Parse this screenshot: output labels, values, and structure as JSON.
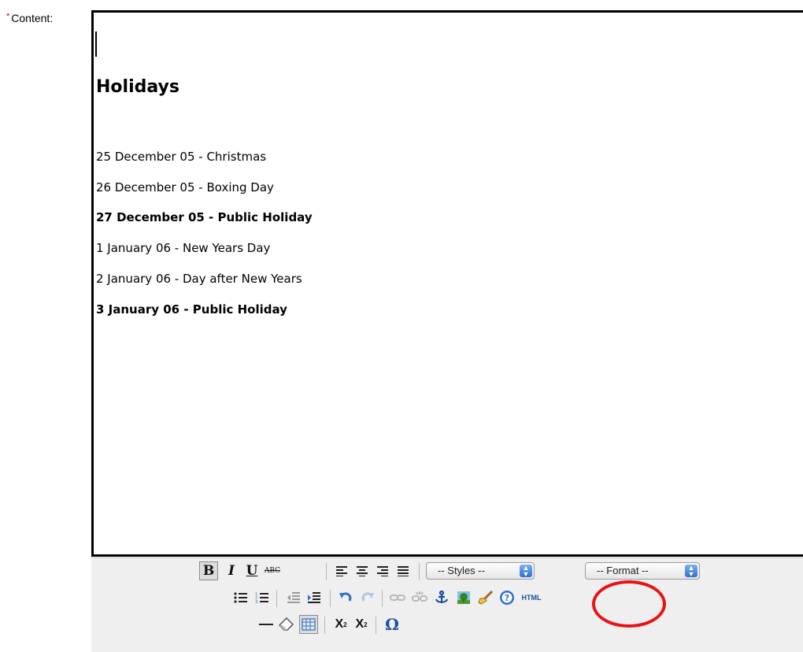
{
  "field": {
    "required_mark": "*",
    "label": "Content:"
  },
  "editor": {
    "heading": "Holidays",
    "lines": [
      {
        "text": "25 December 05 - Christmas",
        "bold": false
      },
      {
        "text": "26 December 05 - Boxing Day",
        "bold": false
      },
      {
        "text": "27 December 05 - Public Holiday",
        "bold": true
      },
      {
        "text": "1 January 06 - New Years Day",
        "bold": false
      },
      {
        "text": "2 January 06 - Day after New Years",
        "bold": false
      },
      {
        "text": "3 January 06 - Public Holiday",
        "bold": true
      }
    ]
  },
  "toolbar": {
    "bold_label": "B",
    "italic_label": "I",
    "underline_label": "U",
    "strike_label": "ABC",
    "styles_select": "-- Styles --",
    "format_select": "-- Format --",
    "html_label": "HTML",
    "subscript_label": "X",
    "superscript_label": "X",
    "charmap_label": "Ω"
  },
  "icons": [
    "bold-icon",
    "italic-icon",
    "underline-icon",
    "strikethrough-icon",
    "align-left-icon",
    "align-center-icon",
    "align-right-icon",
    "align-justify-icon",
    "bullet-list-icon",
    "numbered-list-icon",
    "outdent-icon",
    "indent-icon",
    "undo-icon",
    "redo-icon",
    "link-icon",
    "unlink-icon",
    "anchor-icon",
    "image-icon",
    "cleanup-icon",
    "help-icon",
    "html-source-icon",
    "horizontal-rule-icon",
    "remove-format-icon",
    "table-icon",
    "subscript-icon",
    "superscript-icon",
    "special-character-icon"
  ],
  "colors": {
    "required": "#e00000",
    "annotation": "#e81414",
    "toolbar_bg": "#efefef",
    "accent_blue": "#2f6fd0"
  }
}
